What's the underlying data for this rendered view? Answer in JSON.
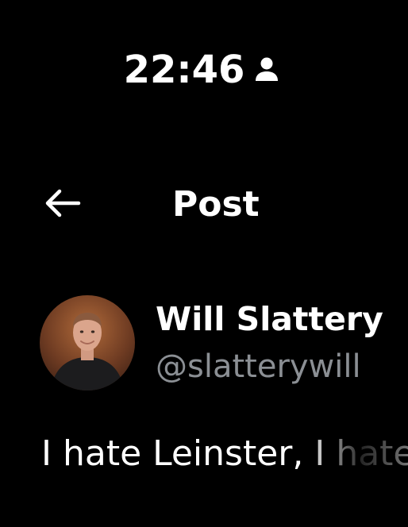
{
  "status_bar": {
    "time": "22:46",
    "icon": "person-icon"
  },
  "header": {
    "back_icon": "arrow-left-icon",
    "title": "Post"
  },
  "author": {
    "name": "Will Slattery",
    "handle": "@slatterywill",
    "avatar_icon": "avatar"
  },
  "post": {
    "text": "I hate Leinster, I hate"
  },
  "colors": {
    "background": "#000000",
    "text_primary": "#ffffff",
    "text_secondary": "#8b8f94"
  }
}
